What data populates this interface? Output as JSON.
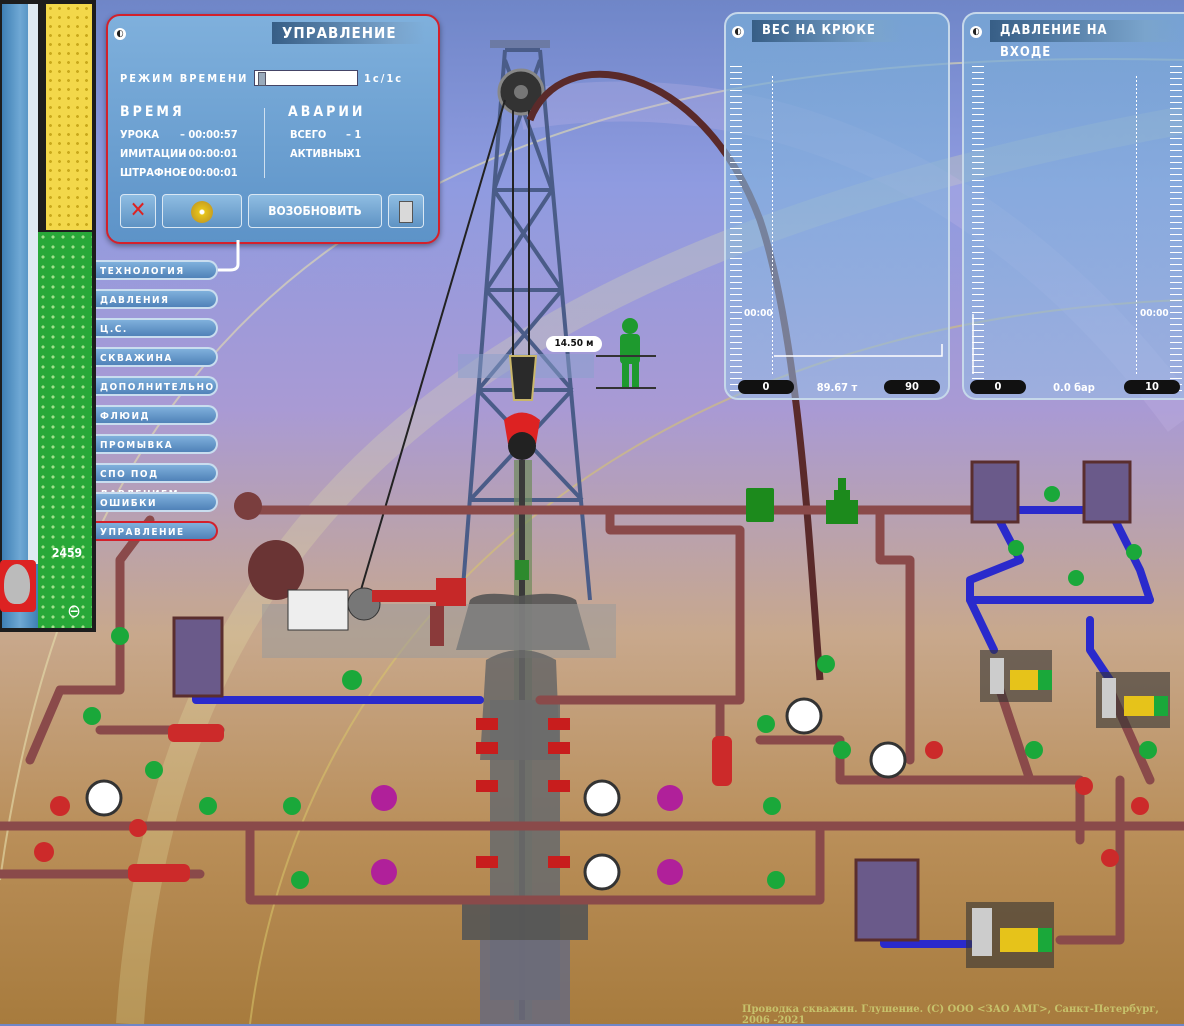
{
  "control_panel": {
    "title": "УПРАВЛЕНИЕ",
    "time_mode_label": "РЕЖИМ ВРЕМЕНИ",
    "time_mode_value": "1с/1с",
    "time_section": {
      "heading": "ВРЕМЯ",
      "rows": [
        {
          "label": "УРОКА",
          "value": "– 00:00:57"
        },
        {
          "label": "ИМИТАЦИИ",
          "value": "– 00:00:01"
        },
        {
          "label": "ШТРАФНОЕ",
          "value": "– 00:00:01"
        }
      ]
    },
    "alarm_section": {
      "heading": "АВАРИИ",
      "rows": [
        {
          "label": "ВСЕГО",
          "value": "– 1"
        },
        {
          "label": "АКТИВНЫХ",
          "value": "– 1"
        }
      ]
    },
    "resume_label": "ВОЗОБНОВИТЬ"
  },
  "menu": {
    "items": [
      {
        "label": "ТЕХНОЛОГИЯ"
      },
      {
        "label": "ДАВЛЕНИЯ"
      },
      {
        "label": "Ц.С."
      },
      {
        "label": "СКВАЖИНА"
      },
      {
        "label": "ДОПОЛНИТЕЛЬНО"
      },
      {
        "label": "ФЛЮИД"
      },
      {
        "label": "ПРОМЫВКА"
      },
      {
        "label": "СПО ПОД ДАВЛЕНИЕМ"
      },
      {
        "label": "ОШИБКИ"
      },
      {
        "label": "УПРАВЛЕНИЕ"
      }
    ]
  },
  "hook_weight_gauge": {
    "title": "ВЕС НА КРЮКЕ",
    "time": "00:00",
    "min": "0",
    "value": "89.67 т",
    "max": "90"
  },
  "inlet_pressure_gauge": {
    "title": "ДАВЛЕНИЕ НА ВХОДЕ",
    "time": "00:00",
    "min": "0",
    "value": "0.0 бар",
    "max": "10"
  },
  "depth_column": {
    "depth": "2459"
  },
  "scene": {
    "hook_height": "14.50 м"
  },
  "footer": "Проводка скважин. Глушение. (С) ООО <ЗАО АМГ>, Санкт-Петербург, 2006 -2021",
  "colors": {
    "pipe": "#8a4a4a",
    "pipe_blue": "#2a2acc",
    "valve_green": "#1aa83a",
    "valve_red": "#cc2a2a",
    "valve_magenta": "#b0209a",
    "panel_border": "#d3202b"
  },
  "icons": {
    "zoom": "zoom-out-icon",
    "alarm_mute": "mute-alarm-icon",
    "disk": "disk-icon",
    "exit": "exit-door-icon"
  }
}
